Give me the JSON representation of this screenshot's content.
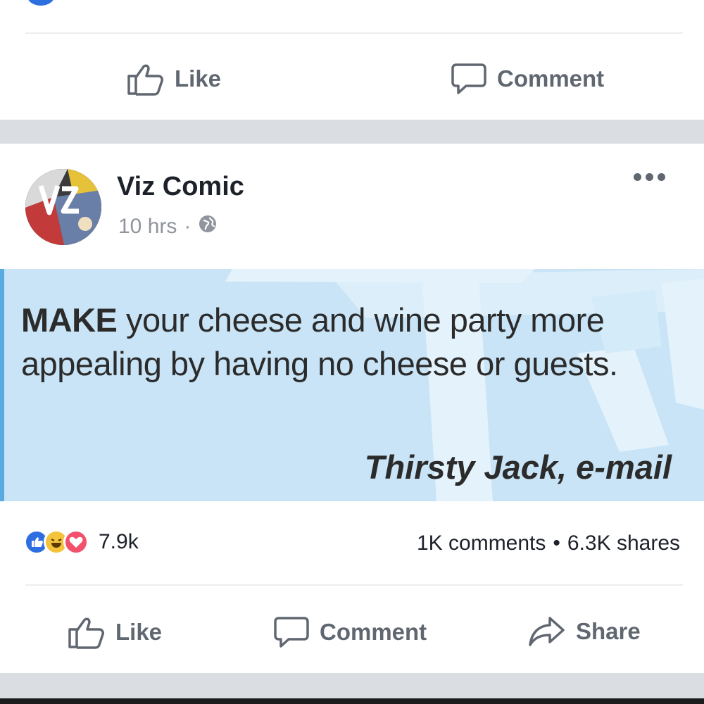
{
  "previous_post": {
    "actions": [
      {
        "label": "Like",
        "icon": "thumbs-up-icon"
      },
      {
        "label": "Comment",
        "icon": "comment-bubble-icon"
      }
    ]
  },
  "post": {
    "page_name": "Viz Comic",
    "timestamp": "10 hrs",
    "separator": "·",
    "privacy_icon": "globe-icon",
    "quote": {
      "emphasis": "MAKE",
      "body": " your cheese and wine party more appealing by having no cheese or guests.",
      "author": "Thirsty Jack, e-mail"
    },
    "reactions": {
      "icons": [
        "like-reaction-icon",
        "haha-reaction-icon",
        "love-reaction-icon"
      ],
      "count": "7.9k"
    },
    "stats": {
      "comments": "1K comments",
      "separator": "•",
      "shares": "6.3K shares"
    },
    "actions": [
      {
        "label": "Like",
        "icon": "thumbs-up-icon"
      },
      {
        "label": "Comment",
        "icon": "comment-bubble-icon"
      },
      {
        "label": "Share",
        "icon": "share-arrow-icon"
      }
    ]
  },
  "colors": {
    "like_blue": "#2f6ee0",
    "haha_yellow": "#f5c33b",
    "love_red": "#f2506b",
    "quote_bg": "#c8e4f6",
    "action_grey": "#606770"
  }
}
